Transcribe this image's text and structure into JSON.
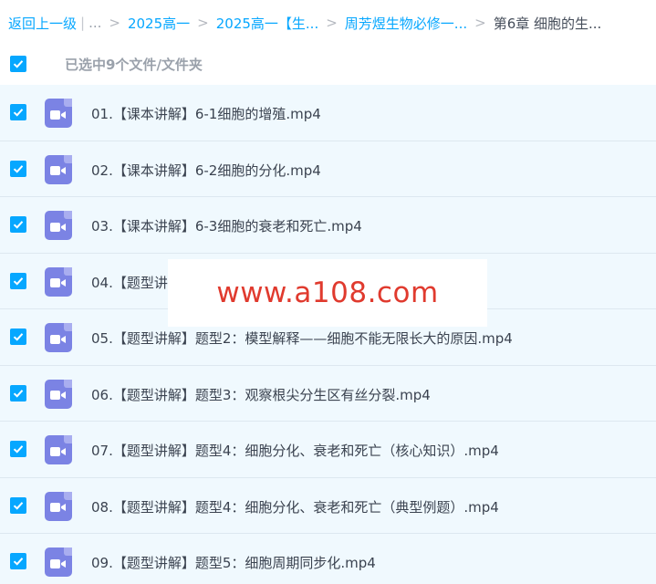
{
  "breadcrumb": {
    "back_label": "返回上一级",
    "ellipsis": "...",
    "items": [
      "2025高一",
      "2025高一【生...",
      "周芳煜生物必修一...",
      "第6章 细胞的生..."
    ]
  },
  "selection": {
    "label": "已选中9个文件/文件夹",
    "all_checked": true
  },
  "files": [
    {
      "name": "01.【课本讲解】6-1细胞的增殖.mp4",
      "checked": true
    },
    {
      "name": "02.【课本讲解】6-2细胞的分化.mp4",
      "checked": true
    },
    {
      "name": "03.【课本讲解】6-3细胞的衰老和死亡.mp4",
      "checked": true
    },
    {
      "name": "04.【题型讲",
      "checked": true
    },
    {
      "name": "05.【题型讲解】题型2：模型解释——细胞不能无限长大的原因.mp4",
      "checked": true
    },
    {
      "name": "06.【题型讲解】题型3：观察根尖分生区有丝分裂.mp4",
      "checked": true
    },
    {
      "name": "07.【题型讲解】题型4：细胞分化、衰老和死亡（核心知识）.mp4",
      "checked": true
    },
    {
      "name": "08.【题型讲解】题型4：细胞分化、衰老和死亡（典型例题）.mp4",
      "checked": true
    },
    {
      "name": "09.【题型讲解】题型5：细胞周期同步化.mp4",
      "checked": true
    }
  ],
  "watermark": "www.a108.com",
  "colors": {
    "accent": "#06a7ff",
    "row_bg": "#f0f9fe",
    "video_icon": "#7b83e4",
    "watermark_text": "#e03a2e"
  },
  "icons": {
    "file_type": "video-file-icon",
    "checkbox": "checkmark-icon"
  }
}
